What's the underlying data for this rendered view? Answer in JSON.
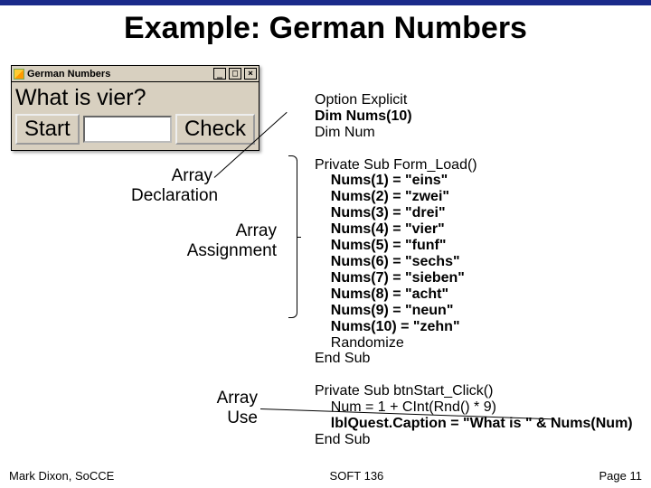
{
  "title": "Example: German Numbers",
  "window": {
    "caption": "German Numbers",
    "question": "What is vier?",
    "start_label": "Start",
    "check_label": "Check",
    "min": "_",
    "max": "□",
    "close": "×"
  },
  "anno": {
    "decl": "Array\nDeclaration",
    "assign": "Array\nAssignment",
    "use": "Array\nUse"
  },
  "code": {
    "l1": "Option Explicit",
    "l2": "Dim Nums(10)",
    "l3": "Dim Num",
    "l4": "",
    "l5": "Private Sub Form_Load()",
    "l6": "    Nums(1) = \"eins\"",
    "l7": "    Nums(2) = \"zwei\"",
    "l8": "    Nums(3) = \"drei\"",
    "l9": "    Nums(4) = \"vier\"",
    "l10": "    Nums(5) = \"funf\"",
    "l11": "    Nums(6) = \"sechs\"",
    "l12": "    Nums(7) = \"sieben\"",
    "l13": "    Nums(8) = \"acht\"",
    "l14": "    Nums(9) = \"neun\"",
    "l15": "    Nums(10) = \"zehn\"",
    "l16": "    Randomize",
    "l17": "End Sub",
    "l18": "",
    "l19": "Private Sub btnStart_Click()",
    "l20": "    Num = 1 + CInt(Rnd() * 9)",
    "l21a": "    lblQuest.Caption = \"What is \" & ",
    "l21b": "Nums(Num)",
    "l22": "End Sub"
  },
  "footer": {
    "left": "Mark Dixon, SoCCE",
    "center": "SOFT 136",
    "right": "Page 11"
  }
}
